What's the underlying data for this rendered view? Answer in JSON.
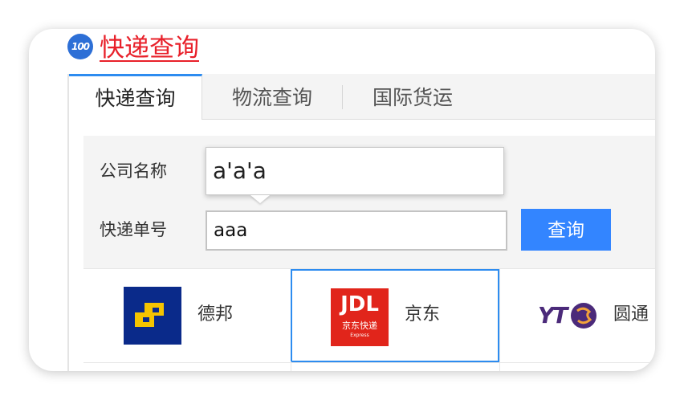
{
  "header": {
    "logo_text": "100",
    "title": "快递查询"
  },
  "tabs": [
    {
      "label": "快递查询",
      "active": true
    },
    {
      "label": "物流查询",
      "active": false
    },
    {
      "label": "国际货运",
      "active": false
    }
  ],
  "form": {
    "company_label": "公司名称",
    "company_value": "a'a'a",
    "number_label": "快递单号",
    "number_value": "aaa",
    "query_button": "查询"
  },
  "carriers": [
    {
      "name": "德邦",
      "logo_icon": "deppon-logo-icon",
      "color": "#0a2a8a",
      "selected": false
    },
    {
      "name": "京东",
      "logo_icon": "jdl-logo-icon",
      "color": "#e1251b",
      "selected": true,
      "logo_text": "JDL",
      "logo_sub": "京东快递",
      "logo_small": "Express"
    },
    {
      "name": "圆通",
      "logo_icon": "yto-logo-icon",
      "color": "#4b2a7a",
      "selected": false,
      "logo_text": "YT"
    }
  ],
  "colors": {
    "accent": "#3385ff",
    "title_red": "#e8202a",
    "tab_indicator": "#2d8cf0"
  }
}
